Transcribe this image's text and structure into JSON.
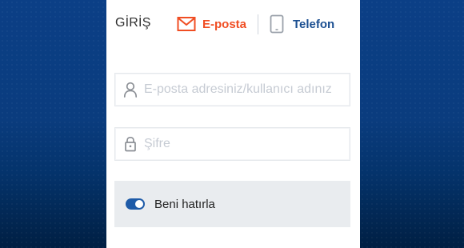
{
  "login": {
    "title": "GİRİŞ",
    "tabs": [
      {
        "label": "E-posta",
        "icon": "envelope-icon",
        "active": true,
        "color": "#f04e23"
      },
      {
        "label": "Telefon",
        "icon": "phone-icon",
        "active": false,
        "color": "#1b4f91"
      }
    ],
    "username": {
      "placeholder": "E-posta adresiniz/kullanıcı adınız",
      "value": "",
      "icon": "user-icon"
    },
    "password": {
      "placeholder": "Şifre",
      "value": "",
      "icon": "lock-icon"
    },
    "remember": {
      "label": "Beni hatırla",
      "checked": true
    }
  },
  "colors": {
    "background": "#0b3f86",
    "accent_orange": "#f04e23",
    "accent_blue": "#1b4f91",
    "toggle": "#1e5ba8"
  }
}
